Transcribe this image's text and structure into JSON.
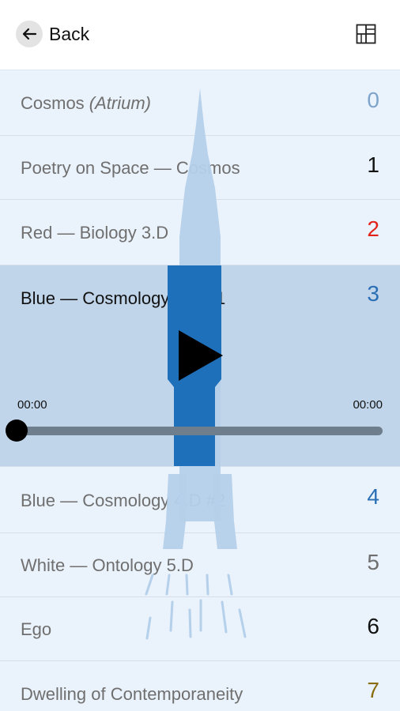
{
  "header": {
    "back_label": "Back",
    "back_icon": "arrow-left-icon",
    "layout_icon": "layout-grid-icon"
  },
  "tracks": [
    {
      "title": "Cosmos ",
      "subtitle": "(Atrium)",
      "number": "0",
      "color": "#7ea4cc"
    },
    {
      "title": "Poetry on Space — Cosmos",
      "number": "1",
      "color": "#111111"
    },
    {
      "title": "Red — Biology 3.D",
      "number": "2",
      "color": "#e2231a"
    },
    {
      "title": "Blue — Cosmology 4.D #1",
      "number": "3",
      "color": "#2a6fb5"
    },
    {
      "title": "Blue — Cosmology 4.D #2",
      "number": "4",
      "color": "#2a6fb5"
    },
    {
      "title": "White — Ontology 5.D",
      "number": "5",
      "color": "#6f6f6f"
    },
    {
      "title": "Ego",
      "number": "6",
      "color": "#111111"
    },
    {
      "title": "Dwelling of Contemporaneity",
      "number": "7",
      "color": "#8a6d10"
    }
  ],
  "player": {
    "elapsed": "00:00",
    "duration": "00:00",
    "progress": 0,
    "play_icon": "play-icon"
  },
  "colors": {
    "rocket_light": "#b5d0ea",
    "rocket_dark": "#1f70bb",
    "active_row": "#a9c6e2",
    "list_bg": "#eaf2fb"
  }
}
